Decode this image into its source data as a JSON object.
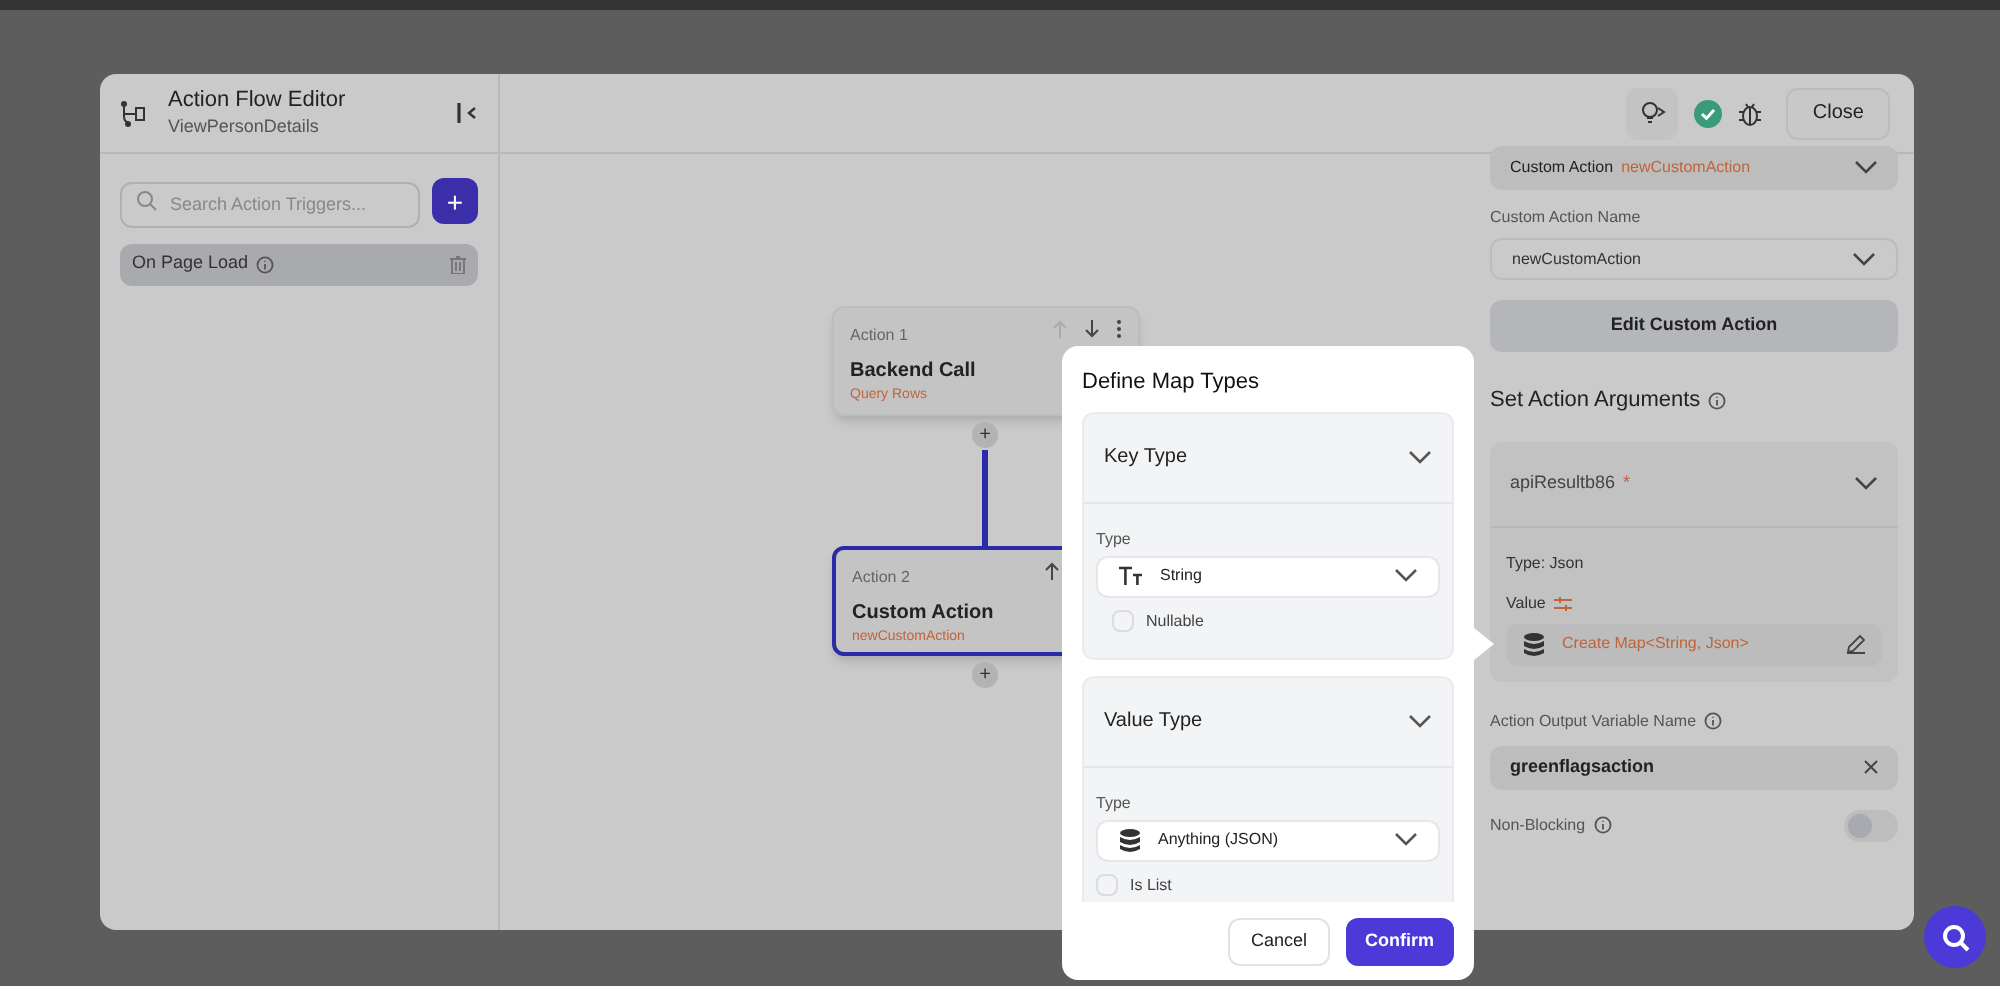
{
  "editor": {
    "title": "Action Flow Editor",
    "subtitle": "ViewPersonDetails",
    "close": "Close"
  },
  "sidebar": {
    "search_placeholder": "Search Action Triggers...",
    "add": "+",
    "triggers": [
      {
        "label": "On Page Load",
        "selected": true
      }
    ]
  },
  "canvas": {
    "actions": [
      {
        "label": "Action 1",
        "title": "Backend Call",
        "subtitle": "Query Rows",
        "selected": false
      },
      {
        "label": "Action 2",
        "title": "Custom Action",
        "subtitle": "newCustomAction",
        "selected": true
      }
    ],
    "add": [
      "+",
      "+"
    ]
  },
  "panel": {
    "action_type": "Custom Action",
    "action_name": "newCustomAction",
    "name_label": "Custom Action Name",
    "name_value": "newCustomAction",
    "edit_button": "Edit Custom Action",
    "arguments_heading": "Set Action Arguments",
    "argument": {
      "name": "apiResultb86",
      "required": "*",
      "type": "Type: Json",
      "value_label": "Value",
      "value": "Create Map<String, Json>"
    },
    "output_label": "Action Output Variable Name",
    "output_value": "greenflagsaction",
    "non_blocking_label": "Non-Blocking",
    "non_blocking_on": false
  },
  "dialog": {
    "title": "Define Map Types",
    "sections": [
      {
        "title": "Key Type",
        "type_label": "Type",
        "type_value": "String",
        "kind": "text",
        "option": "Nullable",
        "checked": false
      },
      {
        "title": "Value Type",
        "type_label": "Type",
        "type_value": "Anything (JSON)",
        "kind": "database",
        "option": "Is List",
        "checked": false
      }
    ],
    "cancel": "Cancel",
    "confirm": "Confirm"
  }
}
